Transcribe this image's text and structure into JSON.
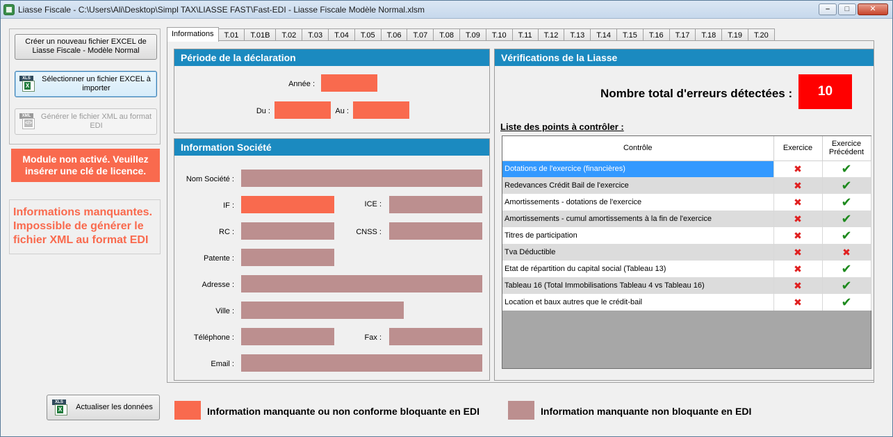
{
  "window": {
    "title": "Liasse Fiscale - C:\\Users\\Ali\\Desktop\\Simpl TAX\\LIASSE FAST\\Fast-EDI - Liasse  Fiscale Modèle Normal.xlsm",
    "minimize_glyph": "–",
    "maximize_glyph": "□",
    "close_glyph": "✕"
  },
  "sidebar": {
    "create_label_1": "Créer un nouveau fichier EXCEL de",
    "create_label_2": "Liasse Fiscale - Modèle Normal",
    "select_label_1": "Sélectionner un fichier EXCEL à",
    "select_label_2": "importer",
    "xml_label_1": "Générer le fichier XML au format",
    "xml_label_2": "EDI",
    "module_msg_1": "Module non activé. Veuillez",
    "module_msg_2": "insérer une clé de licence.",
    "missing_msg_1": "Informations manquantes.",
    "missing_msg_2": "Impossible de générer le",
    "missing_msg_3": "fichier XML au format EDI",
    "refresh_label": "Actualiser les données",
    "xls_tag": "XLS",
    "xml_tag": "XML"
  },
  "tabs": [
    "Informations",
    "T.01",
    "T.01B",
    "T.02",
    "T.03",
    "T.04",
    "T.05",
    "T.06",
    "T.07",
    "T.08",
    "T.09",
    "T.10",
    "T.11",
    "T.12",
    "T.13",
    "T.14",
    "T.15",
    "T.16",
    "T.17",
    "T.18",
    "T.19",
    "T.20"
  ],
  "periode": {
    "title": "Période de la déclaration",
    "annee_label": "Année :",
    "du_label": "Du :",
    "au_label": "Au :"
  },
  "societe": {
    "title": "Information Société",
    "nom_label": "Nom Société :",
    "if_label": "IF :",
    "ice_label": "ICE :",
    "rc_label": "RC :",
    "cnss_label": "CNSS :",
    "patente_label": "Patente :",
    "adresse_label": "Adresse :",
    "ville_label": "Ville :",
    "telephone_label": "Téléphone :",
    "fax_label": "Fax :",
    "email_label": "Email :"
  },
  "verif": {
    "title": "Vérifications de la Liasse",
    "errors_label": "Nombre total d'erreurs détectées :",
    "errors_count": "10",
    "list_title": "Liste des points à contrôler :",
    "col_controle": "Contrôle",
    "col_exercice": "Exercice",
    "col_prec_1": "Exercice",
    "col_prec_2": "Précédent",
    "rows": [
      {
        "label": "Dotations de l'exercice (financières)",
        "exercice": "error",
        "precedent": "ok"
      },
      {
        "label": "Redevances Crédit Bail de l'exercice",
        "exercice": "error",
        "precedent": "ok"
      },
      {
        "label": "Amortissements - dotations de l'exercice",
        "exercice": "error",
        "precedent": "ok"
      },
      {
        "label": "Amortissements - cumul amortissements à la fin de l'exercice",
        "exercice": "error",
        "precedent": "ok"
      },
      {
        "label": "Titres de participation",
        "exercice": "error",
        "precedent": "ok"
      },
      {
        "label": "Tva Déductible",
        "exercice": "error",
        "precedent": "error"
      },
      {
        "label": "Etat de répartition du capital social (Tableau 13)",
        "exercice": "error",
        "precedent": "ok"
      },
      {
        "label": "Tableau 16 (Total Immobilisations Tableau 4 vs Tableau 16)",
        "exercice": "error",
        "precedent": "ok"
      },
      {
        "label": "Location et baux autres que le crédit-bail",
        "exercice": "error",
        "precedent": "ok"
      }
    ],
    "error_glyph": "✖",
    "ok_glyph": "✔"
  },
  "legend": {
    "blocking": "Information manquante ou non conforme bloquante en EDI",
    "non_blocking": "Information manquante non bloquante en EDI"
  },
  "colors": {
    "blocking": "#f96a4e",
    "non_blocking": "#bc8f8f",
    "header": "#1b8ac0",
    "error_badge": "#ff0000",
    "selection": "#3399ff"
  }
}
